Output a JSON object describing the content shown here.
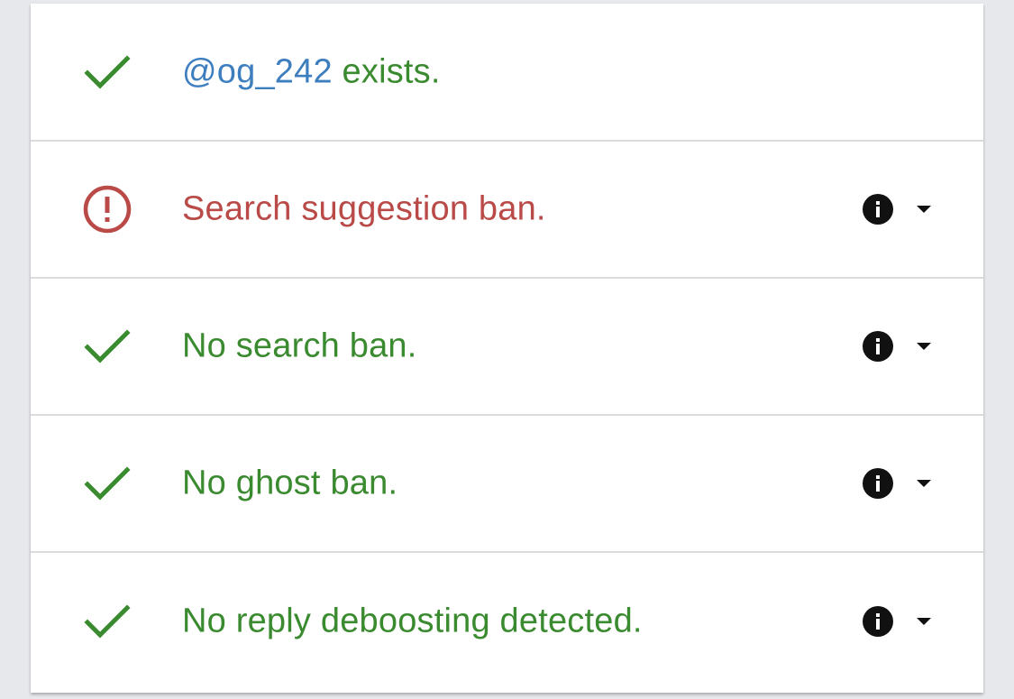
{
  "colors": {
    "success": "#3a8a2f",
    "error": "#b94a48",
    "handle": "#3d7ebf"
  },
  "results": [
    {
      "status": "ok",
      "icon": "check-icon",
      "handle": "@og_242",
      "text": " exists."
    },
    {
      "status": "bad",
      "icon": "alert-circle-icon",
      "text": "Search suggestion ban."
    },
    {
      "status": "ok",
      "icon": "check-icon",
      "text": "No search ban."
    },
    {
      "status": "ok",
      "icon": "check-icon",
      "text": "No ghost ban."
    },
    {
      "status": "ok",
      "icon": "check-icon",
      "text": "No reply deboosting detected."
    }
  ]
}
